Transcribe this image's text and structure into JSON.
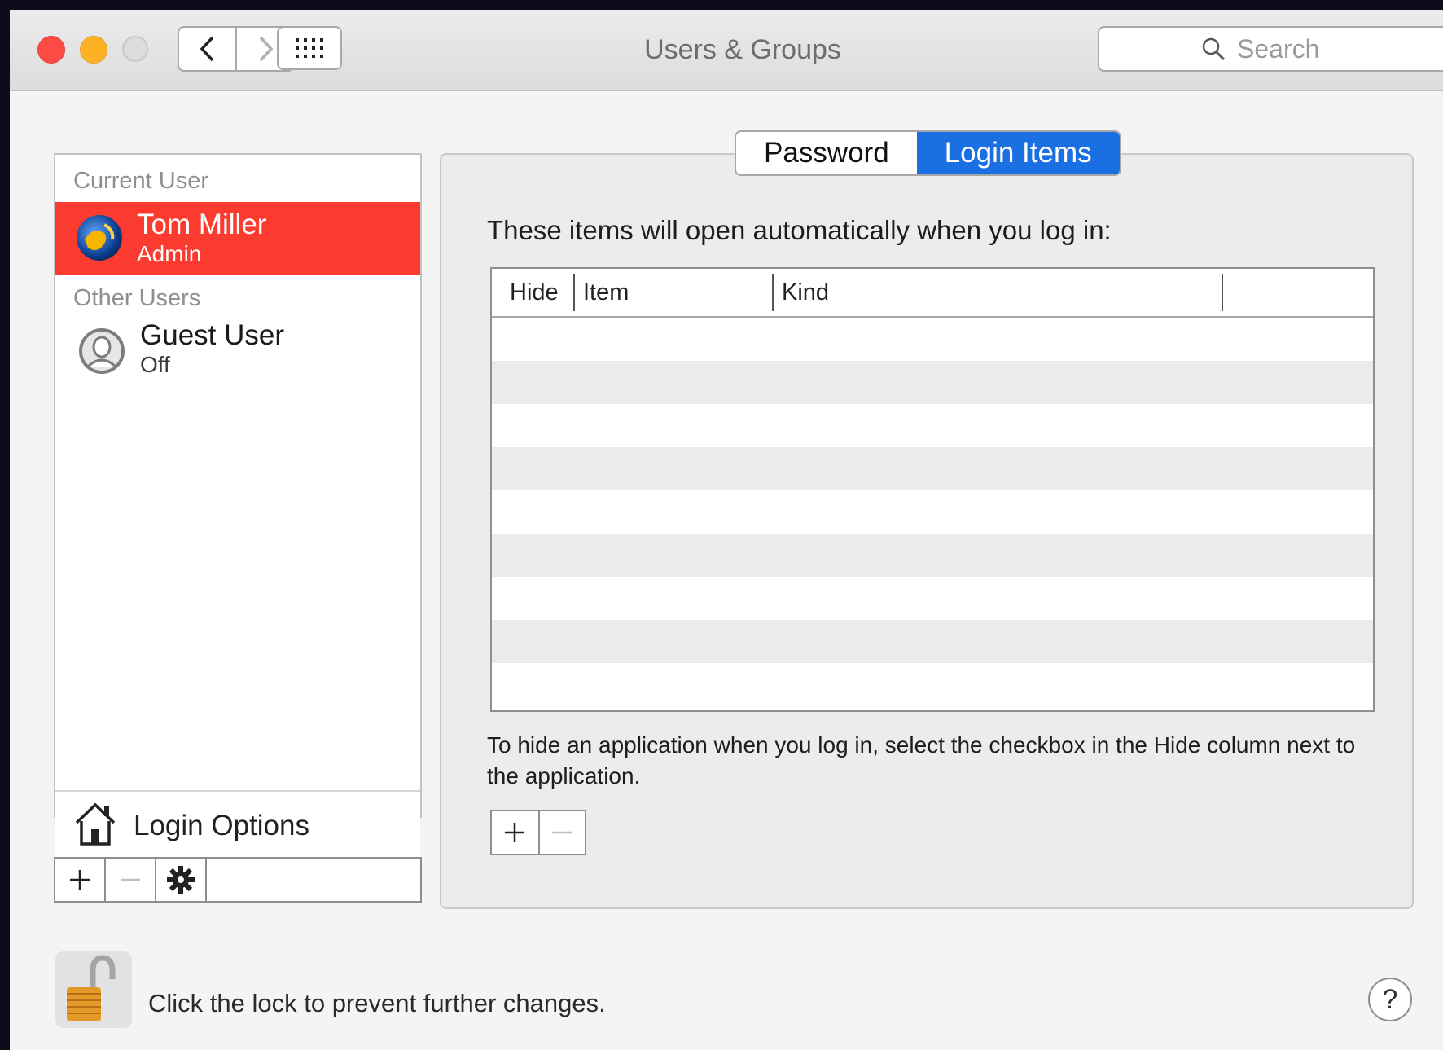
{
  "window": {
    "title": "Users & Groups"
  },
  "toolbar": {
    "icons": {
      "back": "chevron-left-icon",
      "forward": "chevron-right-icon",
      "show_all": "grid-icon"
    },
    "search_placeholder": "Search"
  },
  "sidebar": {
    "current_user_header": "Current User",
    "current_user": {
      "name": "Tom Miller",
      "role": "Admin"
    },
    "other_users_header": "Other Users",
    "other_users": [
      {
        "name": "Guest User",
        "status": "Off"
      }
    ],
    "login_options_label": "Login Options"
  },
  "tabs": [
    {
      "label": "Password",
      "active": false
    },
    {
      "label": "Login Items",
      "active": true
    }
  ],
  "login_items": {
    "heading": "These items will open automatically when you log in:",
    "columns": [
      "Hide",
      "Item",
      "Kind"
    ],
    "rows": [],
    "hint": "To hide an application when you log in, select the checkbox in the Hide column next to the application."
  },
  "footer": {
    "lock_text": "Click the lock to prevent further changes.",
    "help_label": "?"
  },
  "colors": {
    "selected_row": "#fb3b2f",
    "active_tab": "#1a6fe2"
  }
}
